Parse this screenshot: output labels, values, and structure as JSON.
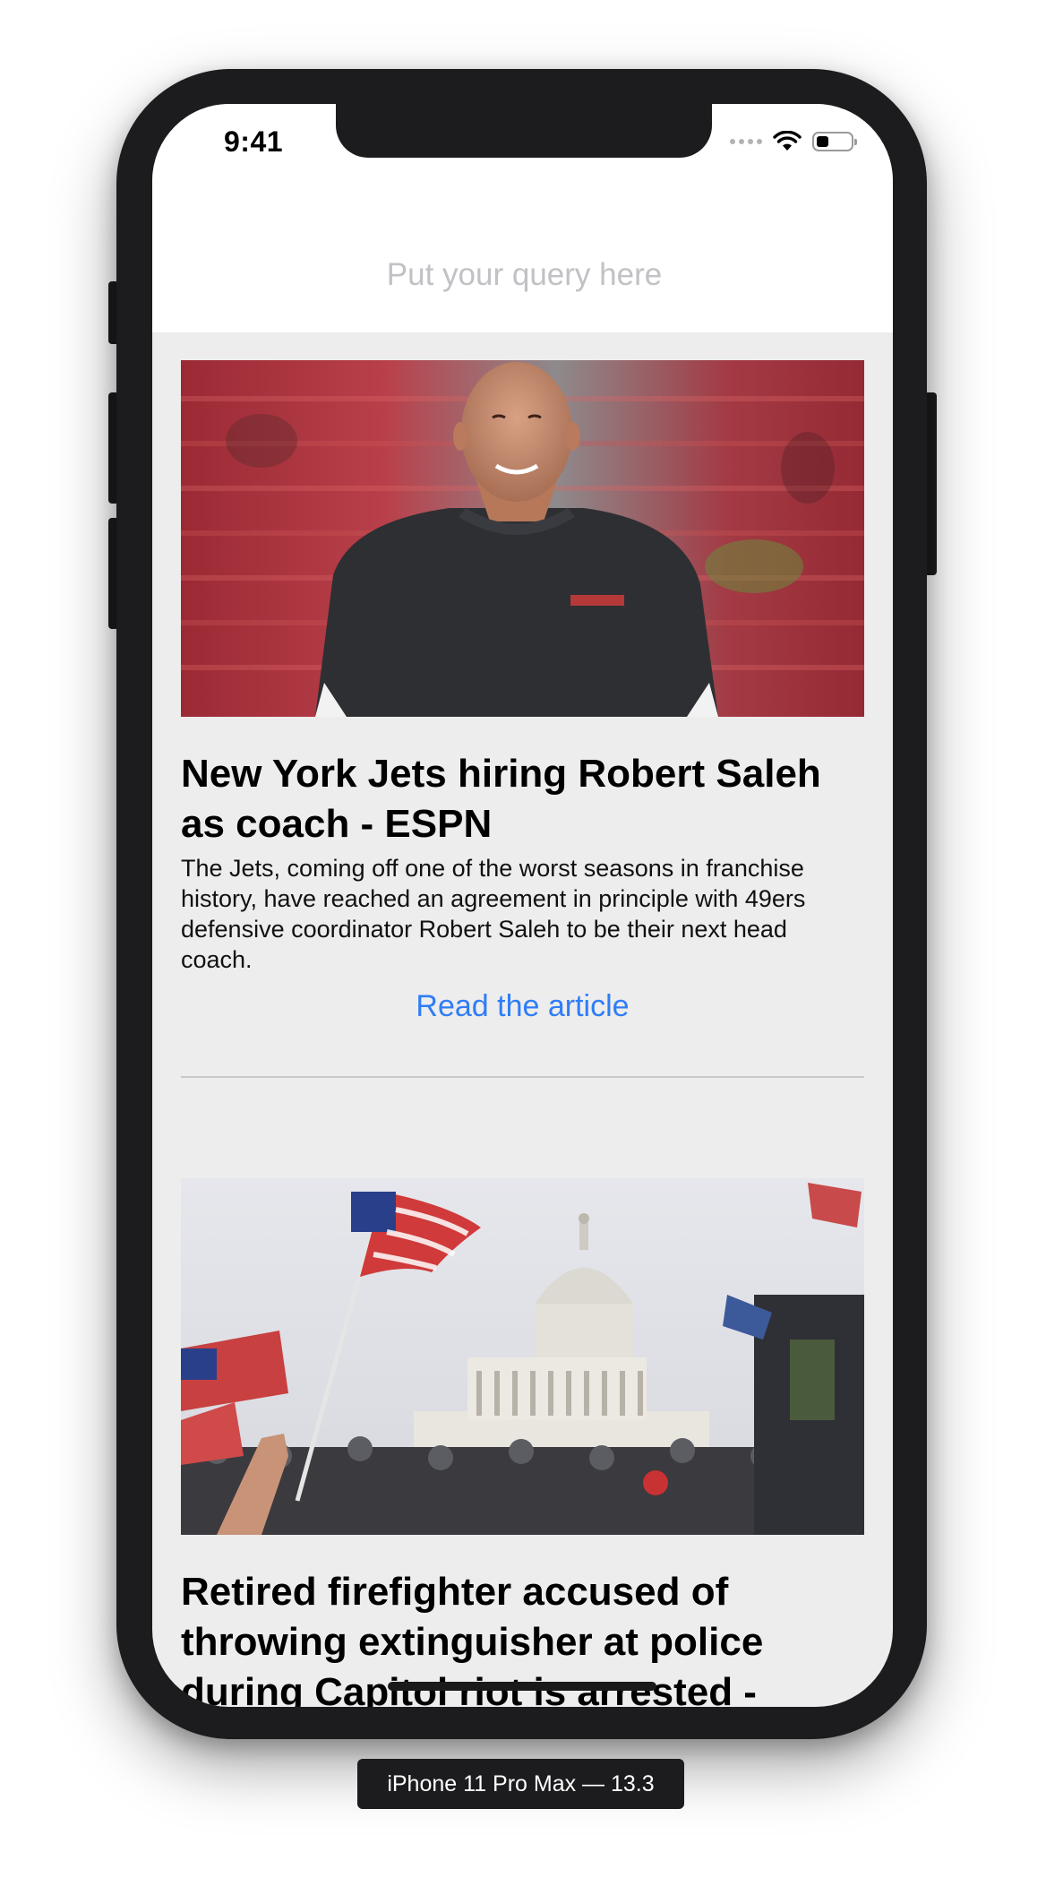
{
  "status_bar": {
    "time": "9:41",
    "icons": [
      "signal-dots-icon",
      "wifi-icon",
      "battery-icon"
    ],
    "battery_level": 0.35
  },
  "search": {
    "placeholder": "Put your query here"
  },
  "articles": [
    {
      "image": "photo of a smiling bald man in a dark 49ers t-shirt in a stadium",
      "title": "New York Jets hiring Robert Saleh as coach - ESPN",
      "description": "The Jets, coming off one of the worst seasons in franchise history, have reached an agreement in principle with 49ers defensive coordinator Robert Saleh to be their next head coach.",
      "link_label": "Read the article"
    },
    {
      "image": "photo of crowd waving American flags in front of the U.S. Capitol",
      "title": "Retired firefighter accused of throwing extinguisher at police during Capitol riot is arrested -",
      "description": "",
      "link_label": ""
    }
  ],
  "device_label": "iPhone 11 Pro Max — 13.3",
  "colors": {
    "link": "#2f7df6",
    "feed_background": "#ededed",
    "device_frame": "#1c1c1e"
  }
}
